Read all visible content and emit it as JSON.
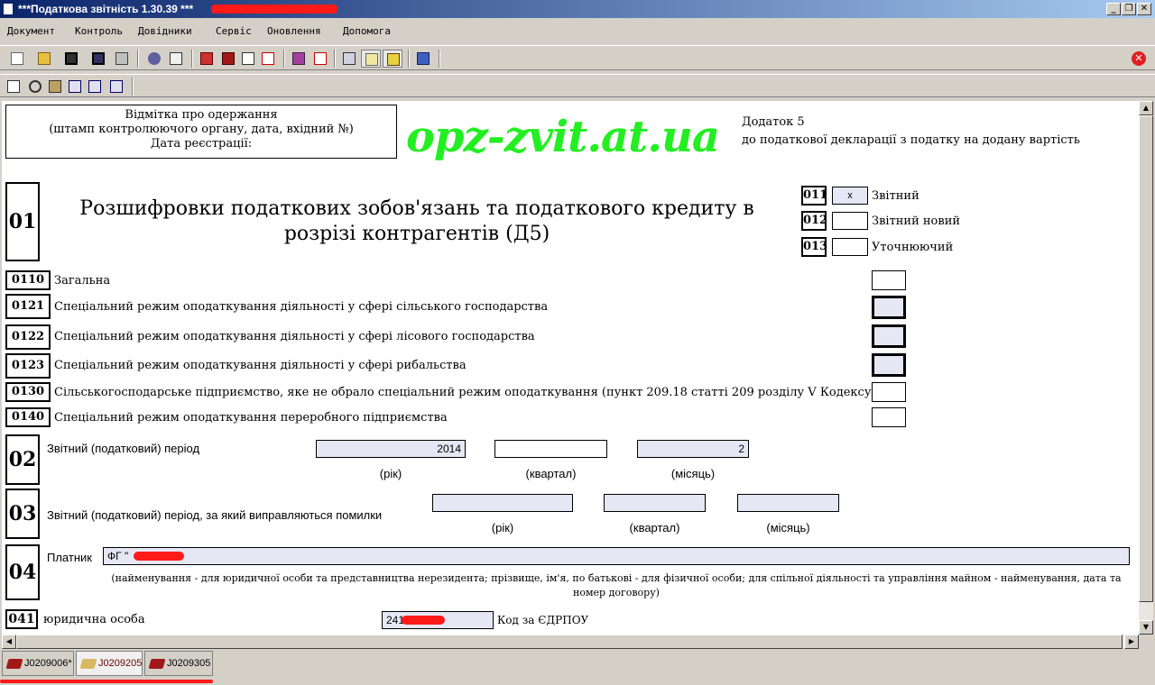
{
  "window": {
    "title": "***Податкова звітність 1.30.39 ***",
    "minimize": "_",
    "restore": "❐",
    "close": "✕"
  },
  "menu": [
    "Документ",
    "Контроль",
    "Довідники",
    "Сервіс",
    "Оновлення",
    "Допомога"
  ],
  "toolbar": {
    "icons": [
      "new-doc-icon",
      "open-folder-icon",
      "save-icon",
      "save-as-icon",
      "print-icon",
      "tools-icon",
      "checklist-icon",
      "home-icon",
      "book-icon",
      "copy-pages-icon",
      "warning-doc-icon",
      "edit-pen-icon",
      "pdf-icon",
      "properties-icon",
      "notes-icon",
      "approve-icon",
      "exit-icon"
    ],
    "close_icon": "✕",
    "edit_icons": [
      "copy-icon",
      "cut-icon",
      "paste-icon",
      "insert-row-icon",
      "split-icon",
      "merge-icon"
    ]
  },
  "form": {
    "stamp": {
      "line1": "Відмітка про одержання",
      "line2": "(штамп контролюючого органу, дата, вхідний №)",
      "line3": "Дата реєстрації:"
    },
    "watermark": "opz-zvit.at.ua",
    "addendum": {
      "line1": "Додаток 5",
      "line2": "до податкової декларації з податку на додану вартість"
    },
    "section01": {
      "num": "01",
      "title": "Розшифровки податкових зобов'язань та податкового кредиту в розрізі контрагентів (Д5)"
    },
    "doc_types": [
      {
        "code": "011",
        "label": "Звітний",
        "value": "x"
      },
      {
        "code": "012",
        "label": "Звітний новий",
        "value": ""
      },
      {
        "code": "013",
        "label": "Уточнюючий",
        "value": ""
      }
    ],
    "regimes": [
      {
        "code": "0110",
        "label": "Загальна"
      },
      {
        "code": "0121",
        "label": "Спеціальний режим оподаткування діяльності у сфері сільського господарства"
      },
      {
        "code": "0122",
        "label": "Спеціальний режим оподаткування діяльності у сфері лісового господарства"
      },
      {
        "code": "0123",
        "label": "Спеціальний режим оподаткування діяльності у сфері рибальства"
      },
      {
        "code": "0130",
        "label": "Сільськогосподарське підприємство, яке не обрало спеціальний режим оподаткування (пункт 209.18 статті 209 розділу V Кодексу)"
      },
      {
        "code": "0140",
        "label": "Спеціальний режим оподаткування переробного підприємства"
      }
    ],
    "section02": {
      "num": "02",
      "label": "Звітний (податковий) період",
      "year": "2014",
      "quarter": "",
      "month": "2",
      "year_label": "(рік)",
      "quarter_label": "(квартал)",
      "month_label": "(місяць)"
    },
    "section03": {
      "num": "03",
      "label": "Звітний (податковий) період, за який виправляються помилки",
      "year": "",
      "quarter": "",
      "month": "",
      "year_label": "(рік)",
      "quarter_label": "(квартал)",
      "month_label": "(місяць)"
    },
    "section04": {
      "num": "04",
      "label": "Платник",
      "value": "ФГ \"",
      "note": "(найменування - для юридичної особи та представництва нерезидента; прізвище, ім'я, по батькові - для фізичної особи; для спільної діяльності та управління майном - найменування, дата та номер договору)"
    },
    "section041": {
      "num": "041",
      "label": "юридична особа",
      "value": "241",
      "code_label": "Код за ЄДРПОУ"
    }
  },
  "doc_tabs": [
    {
      "label": "J0209006*",
      "state": "closed"
    },
    {
      "label": "J0209205",
      "state": "open"
    },
    {
      "label": "J0209305",
      "state": "closed"
    }
  ],
  "colors": {
    "titlebar": "#0a246a",
    "watermark": "#22ee22",
    "field_fill": "#e6e6f4",
    "redaction": "#ff1a1a"
  }
}
